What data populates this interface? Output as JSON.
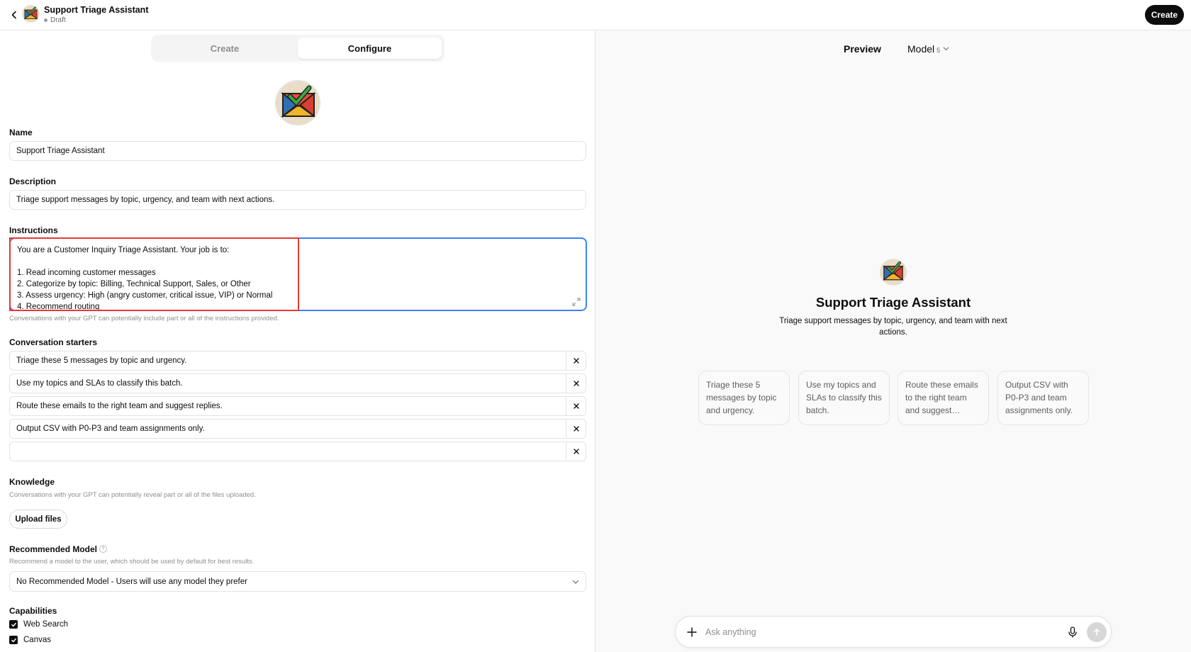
{
  "header": {
    "title": "Support Triage Assistant",
    "status": "Draft",
    "create_button": "Create"
  },
  "tabs": [
    {
      "label": "Create",
      "active": false
    },
    {
      "label": "Configure",
      "active": true
    }
  ],
  "form": {
    "name_label": "Name",
    "name_value": "Support Triage Assistant",
    "description_label": "Description",
    "description_value": "Triage support messages by topic, urgency, and team with next actions.",
    "instructions_label": "Instructions",
    "instructions_value": "You are a Customer Inquiry Triage Assistant. Your job is to:\n\n1. Read incoming customer messages\n2. Categorize by topic: Billing, Technical Support, Sales, or Other\n3. Assess urgency: High (angry customer, critical issue, VIP) or Normal\n4. Recommend routing",
    "instructions_helper": "Conversations with your GPT can potentially include part or all of the instructions provided.",
    "starters_label": "Conversation starters",
    "starters": [
      "Triage these 5 messages by topic and urgency.",
      "Use my topics and SLAs to classify this batch.",
      "Route these emails to the right team and suggest replies.",
      "Output CSV with P0-P3 and team assignments only.",
      ""
    ],
    "knowledge_label": "Knowledge",
    "knowledge_helper": "Conversations with your GPT can potentially reveal part or all of the files uploaded.",
    "upload_button": "Upload files",
    "model_label": "Recommended Model",
    "model_help": "?",
    "model_helper": "Recommend a model to the user, which should be used by default for best results.",
    "model_value": "No Recommended Model - Users will use any model they prefer",
    "capabilities_label": "Capabilities",
    "capabilities": [
      {
        "label": "Web Search",
        "checked": true
      },
      {
        "label": "Canvas",
        "checked": true
      }
    ]
  },
  "preview": {
    "label": "Preview",
    "model_label": "Model",
    "model_version": "5",
    "title": "Support Triage Assistant",
    "description": "Triage support messages by topic, urgency, and team with next actions.",
    "starter_cards": [
      "Triage these 5 messages by topic and urgency.",
      "Use my topics and SLAs to classify this batch.",
      "Route these emails to the right team and suggest…",
      "Output CSV with P0-P3 and team assignments only."
    ],
    "composer_placeholder": "Ask anything"
  },
  "colors": {
    "accent_blue": "#3b82f6",
    "highlight_red": "#e53935",
    "dark": "#0d0d0d"
  },
  "icons": [
    "chevron-left-icon",
    "envelope-check-icon",
    "expand-icon",
    "close-icon",
    "chevron-down-icon",
    "help-icon",
    "checkbox-checked-icon",
    "plus-icon",
    "microphone-icon",
    "arrow-up-icon"
  ]
}
